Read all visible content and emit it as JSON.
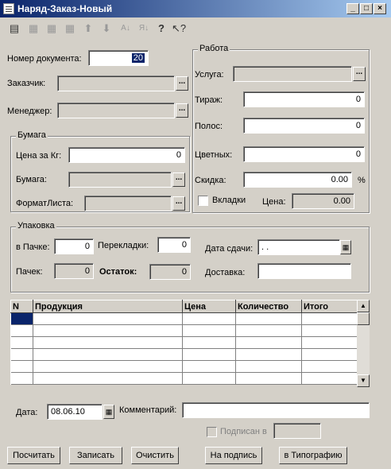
{
  "window": {
    "title": "Наряд-Заказ-Новый"
  },
  "toolbar": {
    "icons": [
      "list-icon",
      "add-row-icon",
      "edit-row-icon",
      "delete-row-icon",
      "arrow-up-icon",
      "arrow-down-icon",
      "sort-asc-icon",
      "sort-desc-icon",
      "help-icon",
      "context-help-icon"
    ]
  },
  "doc": {
    "number_label": "Номер документа:",
    "number_value": "20",
    "customer_label": "Заказчик:",
    "manager_label": "Менеджер:"
  },
  "paper": {
    "title": "Бумага",
    "price_label": "Цена за Кг:",
    "price_value": "0",
    "paper_label": "Бумага:",
    "format_label": "ФорматЛиста:"
  },
  "work": {
    "title": "Работа",
    "service_label": "Услуга:",
    "run_label": "Тираж:",
    "run_value": "0",
    "strips_label": "Полос:",
    "strips_value": "0",
    "colors_label": "Цветных:",
    "colors_value": "0",
    "discount_label": "Скидка:",
    "discount_value": "0.00",
    "discount_unit": "%",
    "inserts_label": "Вкладки",
    "price_label": "Цена:",
    "price_value": "0.00"
  },
  "pack": {
    "title": "Упаковка",
    "perpack_label": "в Пачке:",
    "perpack_value": "0",
    "interlay_label": "Перекладки:",
    "interlay_value": "0",
    "date_label": "Дата сдачи:",
    "date_value": " .  .",
    "packs_label": "Пачек:",
    "packs_value": "0",
    "rest_label": "Остаток:",
    "rest_value": "0",
    "delivery_label": "Доставка:"
  },
  "table": {
    "columns": [
      "N",
      "Продукция",
      "Цена",
      "Количество",
      "Итого"
    ]
  },
  "footer": {
    "date_label": "Дата:",
    "date_value": "08.06.10",
    "comment_label": "Комментарий:",
    "signed_label": "Подписан в"
  },
  "buttons": {
    "calc": "Посчитать",
    "save": "Записать",
    "clear": "Очистить",
    "sign": "На подпись",
    "print": "в Типографию"
  }
}
